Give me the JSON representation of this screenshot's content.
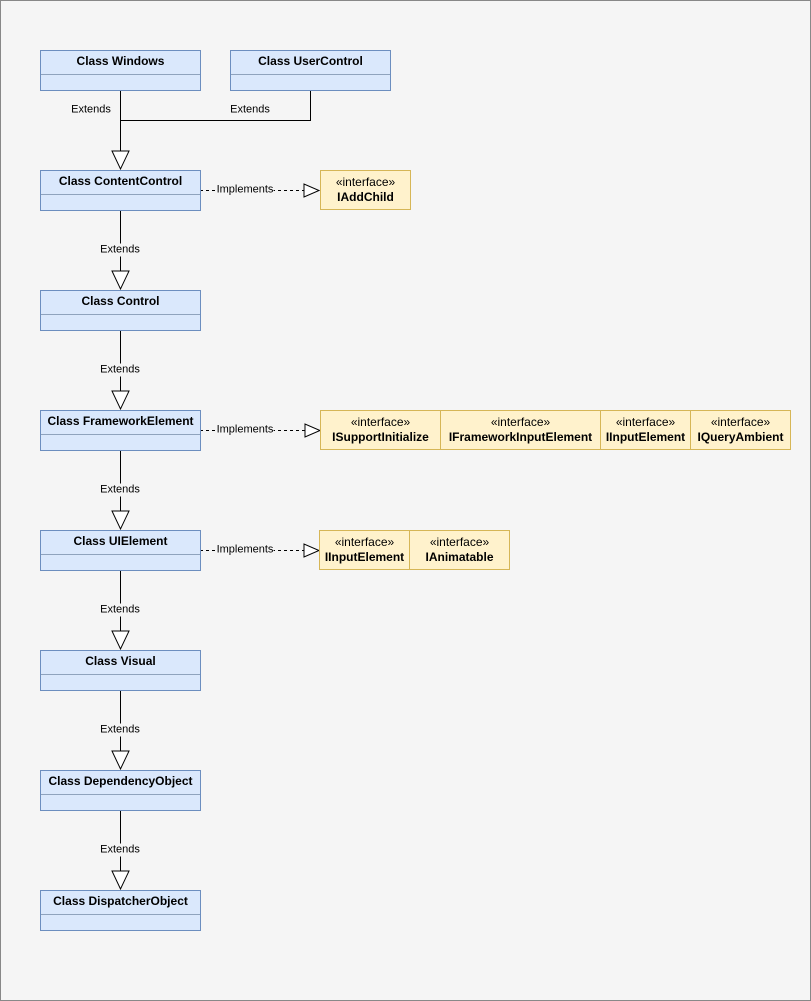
{
  "classes": [
    {
      "id": "windows",
      "name": "Class Windows"
    },
    {
      "id": "usercontrol",
      "name": "Class UserControl"
    },
    {
      "id": "contentcontrol",
      "name": "Class ContentControl"
    },
    {
      "id": "control",
      "name": "Class Control"
    },
    {
      "id": "frameworkelement",
      "name": "Class FrameworkElement"
    },
    {
      "id": "uielement",
      "name": "Class UIElement"
    },
    {
      "id": "visual",
      "name": "Class Visual"
    },
    {
      "id": "dependencyobject",
      "name": "Class DependencyObject"
    },
    {
      "id": "dispatcherobject",
      "name": "Class DispatcherObject"
    }
  ],
  "stereotype": "«interface»",
  "interface_groups": [
    {
      "for": "contentcontrol",
      "items": [
        "IAddChild"
      ]
    },
    {
      "for": "frameworkelement",
      "items": [
        "ISupportInitialize",
        "IFrameworkInputElement",
        "IInputElement",
        "IQueryAmbient"
      ]
    },
    {
      "for": "uielement",
      "items": [
        "IInputElement",
        "IAnimatable"
      ]
    }
  ],
  "edge_labels": {
    "extends": "Extends",
    "implements": "Implements"
  },
  "colors": {
    "class_fill": "#dae8fc",
    "class_border": "#6c8ebf",
    "interface_fill": "#fff2cc",
    "interface_border": "#d6b656",
    "background": "#f5f5f5"
  }
}
